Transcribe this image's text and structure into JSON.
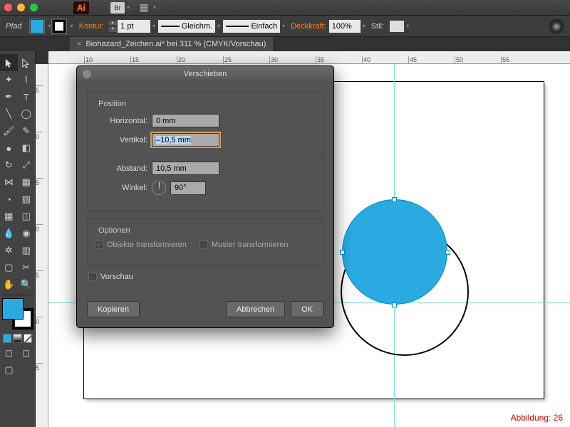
{
  "titlebar": {
    "ai": "Ai",
    "br": "Br"
  },
  "ctrlbar": {
    "path": "Pfad",
    "kontur": "Kontur:",
    "pt": "1 pt",
    "gleich": "Gleichm.",
    "einfach": "Einfach",
    "deck": "Deckkraft:",
    "deckv": "100%",
    "stil": "Stil:"
  },
  "tab": {
    "name": "Biohazard_Zeichen.ai* bei 311 % (CMYK/Vorschau)",
    "x": "×"
  },
  "ruler": {
    "h": [
      "10",
      "15",
      "20",
      "25",
      "30",
      "35",
      "40",
      "45",
      "50",
      "55"
    ],
    "v": [
      "5",
      "0",
      "5",
      "0",
      "5",
      "0",
      "5",
      "0",
      "5"
    ]
  },
  "dialog": {
    "title": "Verschieben",
    "position": "Position",
    "horizontal": "Horizontal:",
    "hval": "0 mm",
    "vertikal": "Vertikal:",
    "vval": "–10,5 mm",
    "abstand": "Abstand:",
    "aval": "10,5 mm",
    "winkel": "Winkel:",
    "wval": "90°",
    "optionen": "Optionen",
    "objtrans": "Objekte transformieren",
    "mustrans": "Muster transformieren",
    "vorschau": "Vorschau",
    "kopieren": "Kopieren",
    "abbrechen": "Abbrechen",
    "ok": "OK"
  },
  "caption": "Abbildung: 26"
}
